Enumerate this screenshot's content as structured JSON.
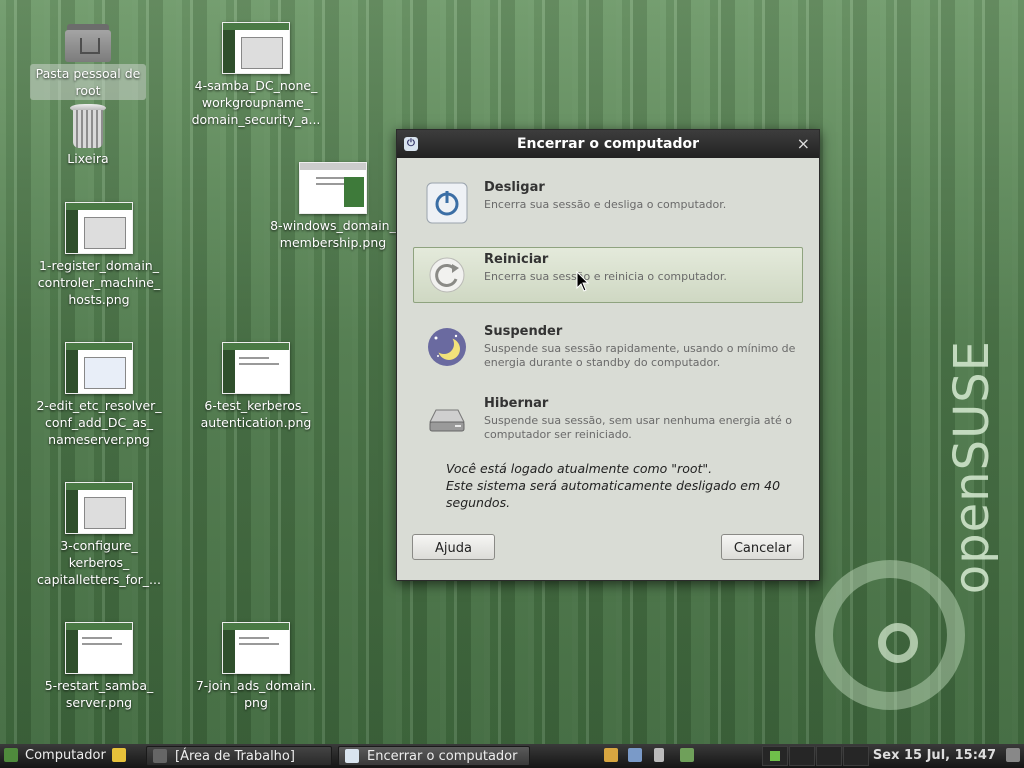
{
  "desktop": {
    "home_label": "Pasta pessoal de root",
    "trash_label": "Lixeira",
    "files": [
      "4-samba_DC_none_ workgroupname_ domain_security_a...",
      "8-windows_domain_ membership.png",
      "1-register_domain_ controler_machine_ hosts.png",
      "2-edit_etc_resolver_ conf_add_DC_as_ nameserver.png",
      "6-test_kerberos_ autentication.png",
      "3-configure_ kerberos_ capitalletters_for_...",
      "5-restart_samba_ server.png",
      "7-join_ads_domain. png"
    ],
    "brand": "openSUSE"
  },
  "dialog": {
    "title": "Encerrar o computador",
    "close_glyph": "×",
    "options": [
      {
        "title": "Desligar",
        "description": "Encerra sua sessão e desliga o computador.",
        "icon": "power-icon"
      },
      {
        "title": "Reiniciar",
        "description": "Encerra sua sessão e reinicia o computador.",
        "icon": "restart-icon"
      },
      {
        "title": "Suspender",
        "description": "Suspende sua sessão rapidamente, usando o mínimo de energia durante o standby do computador.",
        "icon": "moon-icon"
      },
      {
        "title": "Hibernar",
        "description": "Suspende sua sessão, sem usar nenhuma energia até o computador ser reiniciado.",
        "icon": "harddisk-icon"
      }
    ],
    "info_line1": "Você está logado atualmente como \"root\".",
    "info_line2": "Este sistema será automaticamente desligado em 40 segundos.",
    "help_label": "Ajuda",
    "cancel_label": "Cancelar"
  },
  "taskbar": {
    "menu_label": "Computador",
    "windows": [
      {
        "label": "[Área de Trabalho]",
        "active": false
      },
      {
        "label": "Encerrar o computador",
        "active": true
      }
    ],
    "clock": "Sex 15 Jul, 15:47"
  }
}
